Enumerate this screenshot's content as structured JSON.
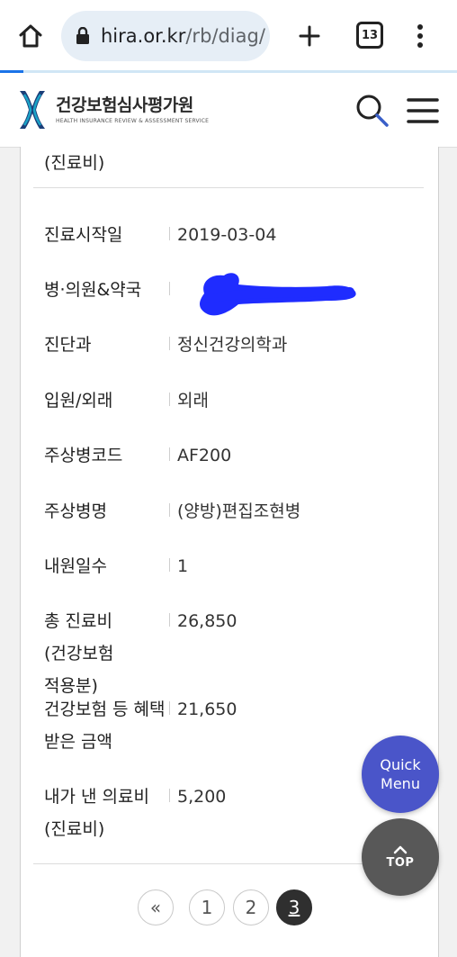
{
  "browser": {
    "url_host": "hira.or.kr",
    "url_path": "/rb/diag/",
    "tab_count": "13"
  },
  "header": {
    "logo_title": "건강보험심사평가원",
    "logo_subtitle": "HEALTH INSURANCE REVIEW & ASSESSMENT SERVICE"
  },
  "record": {
    "prev_tail": "(진료비)",
    "rows": [
      {
        "label": "진료시작일",
        "value": "2019-03-04"
      },
      {
        "label": "병·의원&약국",
        "value": ""
      },
      {
        "label": "진단과",
        "value": "정신건강의학과"
      },
      {
        "label": "입원/외래",
        "value": "외래"
      },
      {
        "label": "주상병코드",
        "value": "AF200"
      },
      {
        "label": "주상병명",
        "value": "(양방)편집조현병"
      },
      {
        "label": "내원일수",
        "value": "1"
      },
      {
        "label": "총 진료비(건강보험 적용분)",
        "value": "26,850"
      },
      {
        "label": "건강보험 등 혜택 받은 금액",
        "value": "21,650"
      },
      {
        "label": "내가 낸 의료비(진료비)",
        "value": "5,200"
      }
    ]
  },
  "pagination": {
    "first": "«",
    "pages": [
      "1",
      "2",
      "3"
    ],
    "current": "3"
  },
  "floating": {
    "quick_line1": "Quick",
    "quick_line2": "Menu",
    "top_label": "TOP"
  },
  "colors": {
    "quick_menu_bg": "#4a55c9",
    "top_btn_bg": "#585858",
    "redaction": "#1f2cff",
    "logo_accent": "#1aa3c7"
  }
}
